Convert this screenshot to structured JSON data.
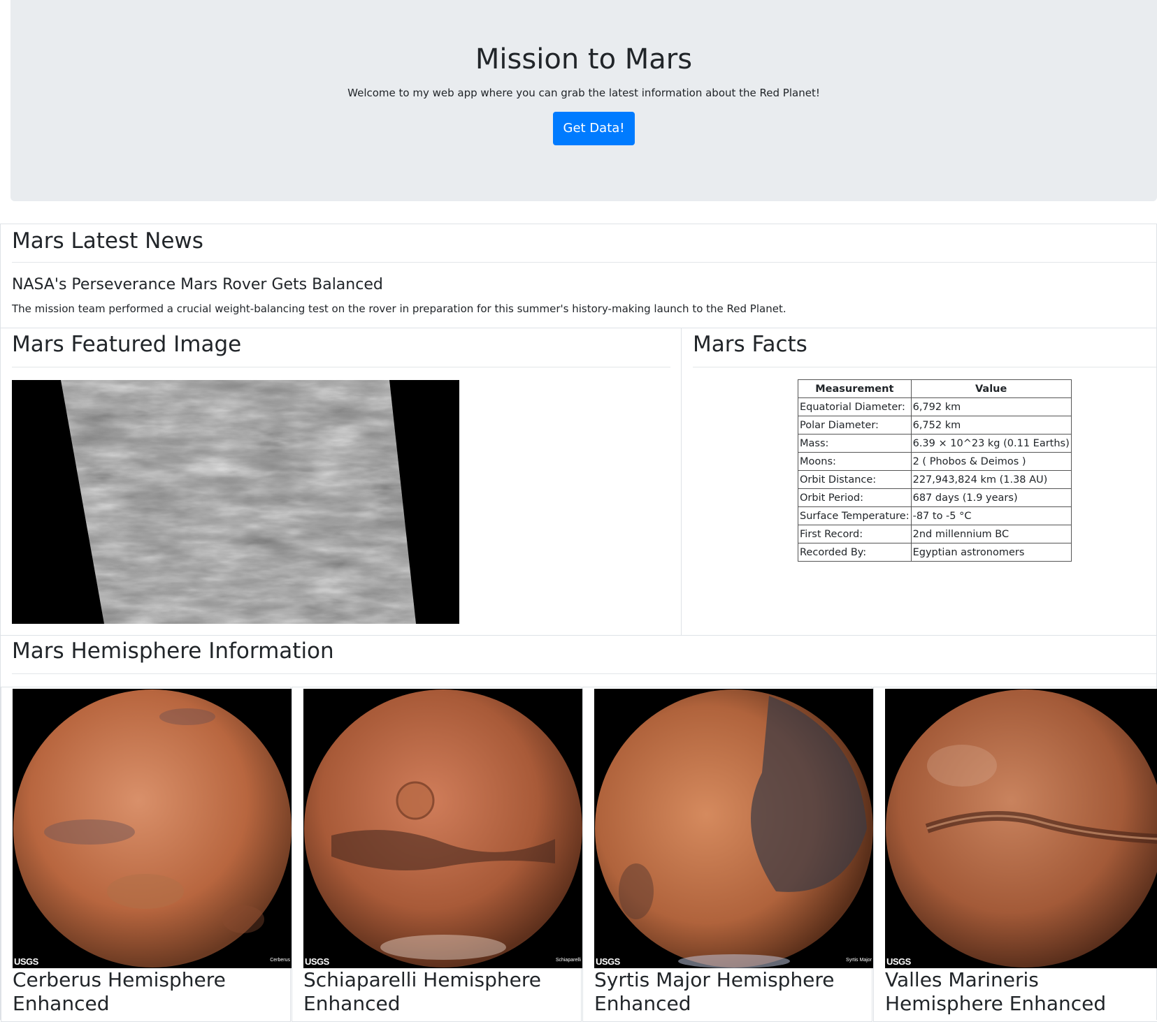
{
  "header": {
    "title": "Mission to Mars",
    "subtitle": "Welcome to my web app where you can grab the latest information about the Red Planet!",
    "button_label": "Get Data!"
  },
  "news": {
    "section_title": "Mars Latest News",
    "headline": "NASA's Perseverance Mars Rover Gets Balanced",
    "teaser": "The mission team performed a crucial weight-balancing test on the rover in preparation for this summer's history-making launch to the Red Planet."
  },
  "featured": {
    "section_title": "Mars Featured Image"
  },
  "facts": {
    "section_title": "Mars Facts",
    "headers": [
      "Measurement",
      "Value"
    ],
    "rows": [
      [
        "Equatorial Diameter:",
        "6,792 km"
      ],
      [
        "Polar Diameter:",
        "6,752 km"
      ],
      [
        "Mass:",
        "6.39 × 10^23 kg (0.11 Earths)"
      ],
      [
        "Moons:",
        "2 ( Phobos & Deimos )"
      ],
      [
        "Orbit Distance:",
        "227,943,824 km (1.38 AU)"
      ],
      [
        "Orbit Period:",
        "687 days (1.9 years)"
      ],
      [
        "Surface Temperature:",
        "-87 to -5 °C"
      ],
      [
        "First Record:",
        "2nd millennium BC"
      ],
      [
        "Recorded By:",
        "Egyptian astronomers"
      ]
    ]
  },
  "hemispheres": {
    "section_title": "Mars Hemisphere Information",
    "items": [
      {
        "title": "Cerberus Hemisphere Enhanced",
        "image_label": "Cerberus",
        "logo": "USGS"
      },
      {
        "title": "Schiaparelli Hemisphere Enhanced",
        "image_label": "Schiaparelli",
        "logo": "USGS"
      },
      {
        "title": "Syrtis Major Hemisphere Enhanced",
        "image_label": "Syrtis Major",
        "logo": "USGS"
      },
      {
        "title": "Valles Marineris Hemisphere Enhanced",
        "image_label": "",
        "logo": "USGS"
      }
    ]
  }
}
